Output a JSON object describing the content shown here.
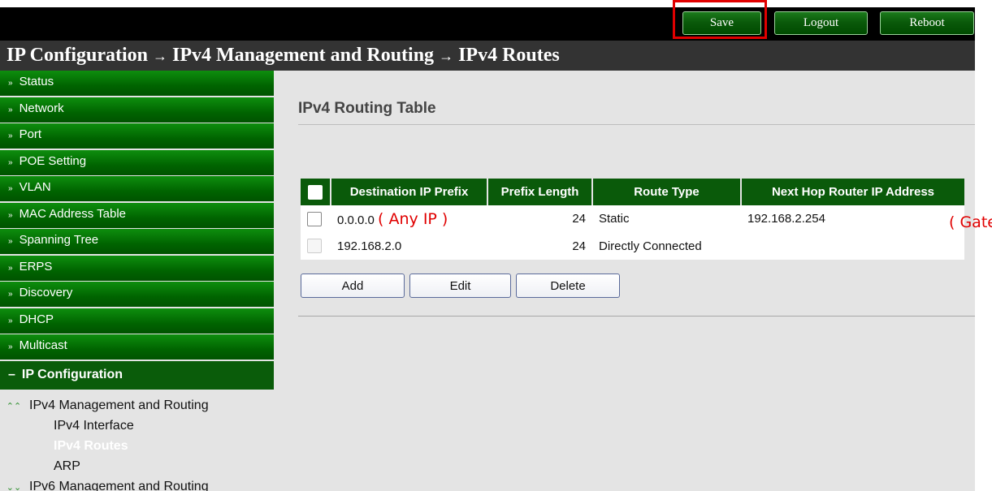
{
  "topbar": {
    "save_label": "Save",
    "logout_label": "Logout",
    "reboot_label": "Reboot"
  },
  "breadcrumb": {
    "part1": "IP Configuration",
    "part2": "IPv4 Management and Routing",
    "part3": "IPv4 Routes",
    "separator": "→"
  },
  "sidebar": {
    "items": [
      {
        "label": "Status"
      },
      {
        "label": "Network"
      },
      {
        "label": "Port"
      },
      {
        "label": "POE Setting"
      },
      {
        "label": "VLAN"
      },
      {
        "label": "MAC Address Table"
      },
      {
        "label": "Spanning Tree"
      },
      {
        "label": "ERPS"
      },
      {
        "label": "Discovery"
      },
      {
        "label": "DHCP"
      },
      {
        "label": "Multicast"
      }
    ],
    "open_section": "IP Configuration",
    "submenu": {
      "group1": "IPv4 Management and Routing",
      "ipv4_interface": "IPv4 Interface",
      "ipv4_routes": "IPv4 Routes",
      "arp": "ARP",
      "group2": "IPv6 Management and Routing"
    }
  },
  "main": {
    "title": "IPv4 Routing Table",
    "columns": [
      "Destination IP Prefix",
      "Prefix Length",
      "Route Type",
      "Next Hop Router IP Address"
    ],
    "rows": [
      {
        "dest": "0.0.0.0",
        "prefix_len": "24",
        "type": "Static",
        "next_hop": "192.168.2.254"
      },
      {
        "dest": "192.168.2.0",
        "prefix_len": "24",
        "type": "Directly Connected",
        "next_hop": ""
      }
    ],
    "buttons": {
      "add": "Add",
      "edit": "Edit",
      "delete": "Delete"
    }
  },
  "annotations": {
    "any_ip": "( Any IP )",
    "gateway_ip": "( Gateway IP )"
  },
  "colors": {
    "menu_green": "#006400",
    "highlight_red": "#e00000",
    "header_dark": "#333333"
  },
  "icons": {
    "menu_collapsed": "double-chevron-down-icon",
    "menu_expanded": "minus-icon",
    "group_expanded": "double-chevron-up-icon",
    "group_collapsed": "double-chevron-down-icon"
  }
}
